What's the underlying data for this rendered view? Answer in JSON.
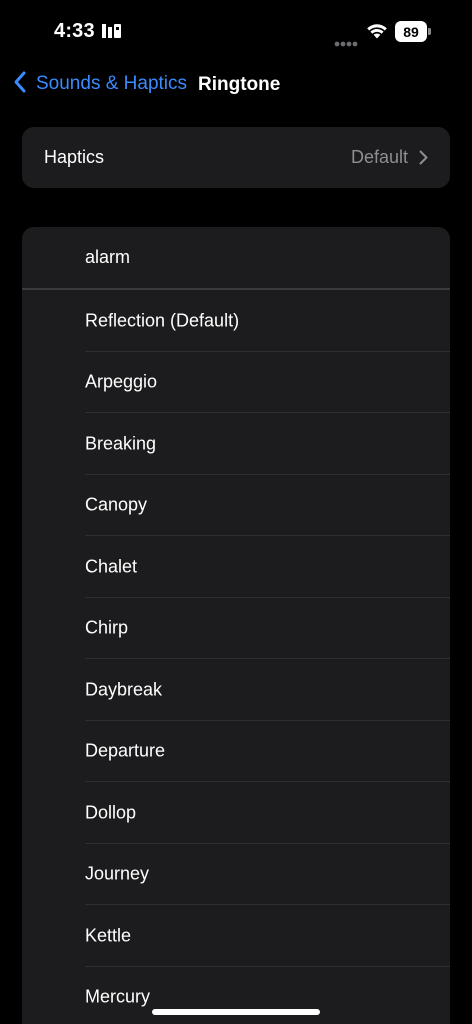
{
  "status_bar": {
    "time": "4:33",
    "time_icon": "id-card-icon",
    "cellular_icon": "cellular-dots-icon",
    "wifi_icon": "wifi-icon",
    "battery_level": "89"
  },
  "nav": {
    "back_label": "Sounds & Haptics",
    "back_icon": "chevron-left-icon",
    "title": "Ringtone"
  },
  "haptics": {
    "label": "Haptics",
    "value": "Default",
    "chevron_icon": "chevron-right-icon"
  },
  "custom_tones": [
    {
      "label": "alarm"
    }
  ],
  "ringtones": [
    {
      "label": "Reflection (Default)"
    },
    {
      "label": "Arpeggio"
    },
    {
      "label": "Breaking"
    },
    {
      "label": "Canopy"
    },
    {
      "label": "Chalet"
    },
    {
      "label": "Chirp"
    },
    {
      "label": "Daybreak"
    },
    {
      "label": "Departure"
    },
    {
      "label": "Dollop"
    },
    {
      "label": "Journey"
    },
    {
      "label": "Kettle"
    },
    {
      "label": "Mercury"
    }
  ],
  "colors": {
    "background": "#000000",
    "group_background": "#1c1c1e",
    "accent": "#3a8bfd",
    "secondary_text": "#8d8d93",
    "separator": "#2f2f31"
  }
}
